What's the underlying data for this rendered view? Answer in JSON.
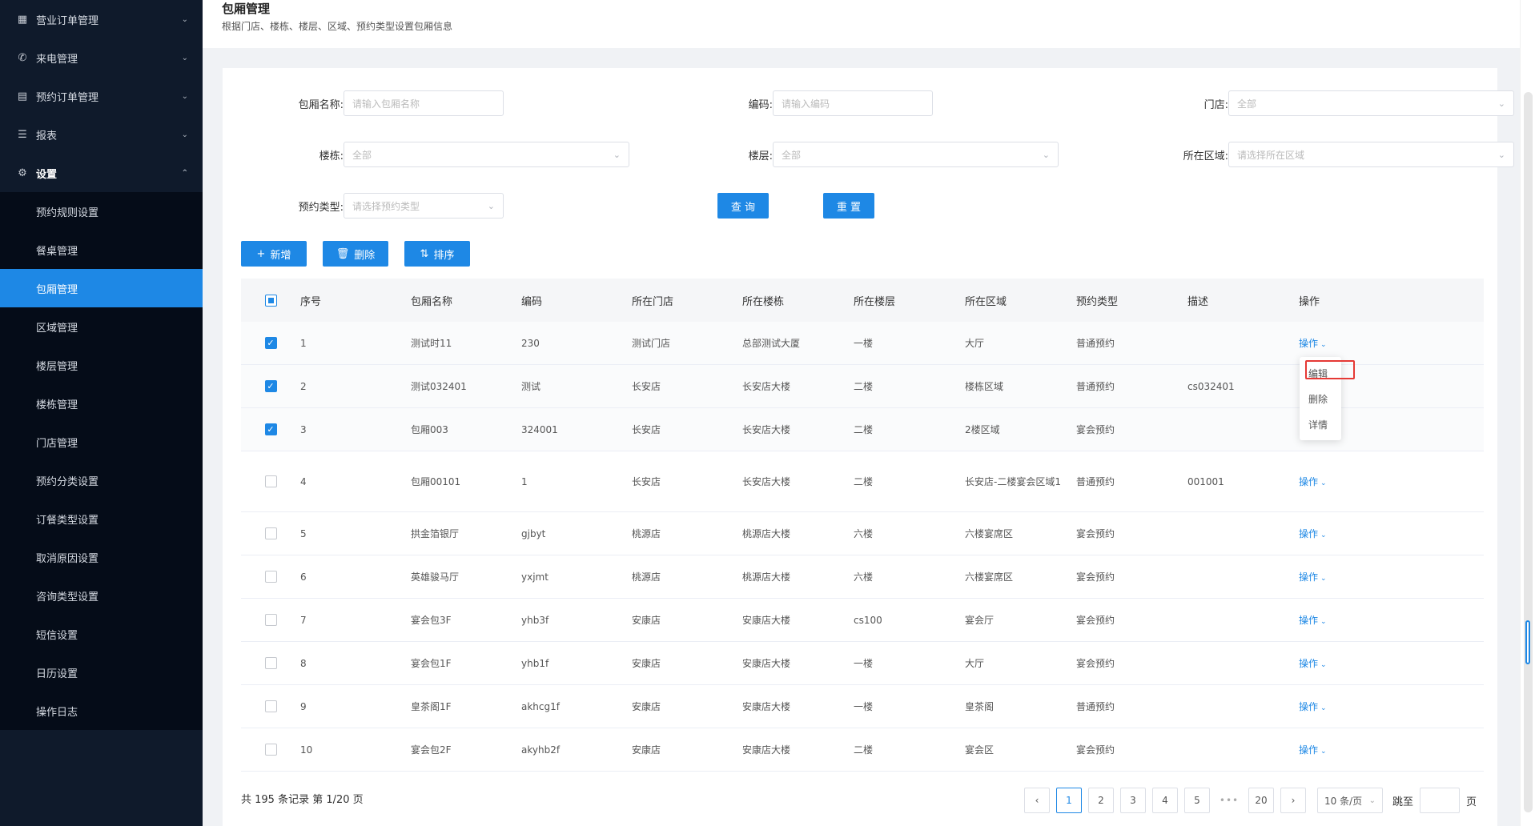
{
  "sidebar": {
    "menus": [
      {
        "label": "营业订单管理",
        "icon": "grid-icon",
        "glyph": "▦",
        "arrow": "⌄"
      },
      {
        "label": "来电管理",
        "icon": "phone-icon",
        "glyph": "✆",
        "arrow": "⌄"
      },
      {
        "label": "预约订单管理",
        "icon": "list-icon",
        "glyph": "▤",
        "arrow": "⌄"
      },
      {
        "label": "报表",
        "icon": "menu-icon",
        "glyph": "☰",
        "arrow": "⌄"
      },
      {
        "label": "设置",
        "icon": "gear-icon",
        "glyph": "⚙",
        "arrow": "⌃"
      }
    ],
    "submenu": [
      "预约规则设置",
      "餐桌管理",
      "包厢管理",
      "区域管理",
      "楼层管理",
      "楼栋管理",
      "门店管理",
      "预约分类设置",
      "订餐类型设置",
      "取消原因设置",
      "咨询类型设置",
      "短信设置",
      "日历设置",
      "操作日志"
    ],
    "active": "包厢管理"
  },
  "header": {
    "title": "包厢管理",
    "desc": "根据门店、楼栋、楼层、区域、预约类型设置包厢信息"
  },
  "filters": {
    "name_label": "包厢名称:",
    "name_placeholder": "请输入包厢名称",
    "code_label": "编码:",
    "code_placeholder": "请输入编码",
    "store_label": "门店:",
    "store_value": "全部",
    "building_label": "楼栋:",
    "building_value": "全部",
    "floor_label": "楼层:",
    "floor_value": "全部",
    "area_label": "所在区域:",
    "area_placeholder": "请选择所在区域",
    "type_label": "预约类型:",
    "type_placeholder": "请选择预约类型",
    "query_btn": "查 询",
    "reset_btn": "重 置"
  },
  "toolbar": {
    "add": "新增",
    "delete": "删除",
    "sort": "排序"
  },
  "table": {
    "columns": [
      "序号",
      "包厢名称",
      "编码",
      "所在门店",
      "所在楼栋",
      "所在楼层",
      "所在区域",
      "预约类型",
      "描述",
      "操作"
    ],
    "rows": [
      {
        "checked": true,
        "no": "1",
        "name": "测试时11",
        "code": "230",
        "store": "测试门店",
        "building": "总部测试大厦",
        "floor": "一楼",
        "area": "大厅",
        "type": "普通预约",
        "desc": "",
        "op": "操作"
      },
      {
        "checked": true,
        "no": "2",
        "name": "测试032401",
        "code": "测试",
        "store": "长安店",
        "building": "长安店大楼",
        "floor": "二楼",
        "area": "楼栋区域",
        "type": "普通预约",
        "desc": "cs032401",
        "op": ""
      },
      {
        "checked": true,
        "no": "3",
        "name": "包厢003",
        "code": "324001",
        "store": "长安店",
        "building": "长安店大楼",
        "floor": "二楼",
        "area": "2楼区域",
        "type": "宴会预约",
        "desc": "",
        "op": ""
      },
      {
        "checked": false,
        "no": "4",
        "name": "包厢00101",
        "code": "1",
        "store": "长安店",
        "building": "长安店大楼",
        "floor": "二楼",
        "area": "长安店-二楼宴会区域1",
        "type": "普通预约",
        "desc": "001001",
        "op": "操作"
      },
      {
        "checked": false,
        "no": "5",
        "name": "拱金箔银厅",
        "code": "gjbyt",
        "store": "桃源店",
        "building": "桃源店大楼",
        "floor": "六楼",
        "area": "六楼宴席区",
        "type": "宴会预约",
        "desc": "",
        "op": "操作"
      },
      {
        "checked": false,
        "no": "6",
        "name": "英雄骏马厅",
        "code": "yxjmt",
        "store": "桃源店",
        "building": "桃源店大楼",
        "floor": "六楼",
        "area": "六楼宴席区",
        "type": "宴会预约",
        "desc": "",
        "op": "操作"
      },
      {
        "checked": false,
        "no": "7",
        "name": "宴会包3F",
        "code": "yhb3f",
        "store": "安康店",
        "building": "安康店大楼",
        "floor": "cs100",
        "area": "宴会厅",
        "type": "宴会预约",
        "desc": "",
        "op": "操作"
      },
      {
        "checked": false,
        "no": "8",
        "name": "宴会包1F",
        "code": "yhb1f",
        "store": "安康店",
        "building": "安康店大楼",
        "floor": "一楼",
        "area": "大厅",
        "type": "宴会预约",
        "desc": "",
        "op": "操作"
      },
      {
        "checked": false,
        "no": "9",
        "name": "皇茶阁1F",
        "code": "akhcg1f",
        "store": "安康店",
        "building": "安康店大楼",
        "floor": "一楼",
        "area": "皇茶阁",
        "type": "普通预约",
        "desc": "",
        "op": "操作"
      },
      {
        "checked": false,
        "no": "10",
        "name": "宴会包2F",
        "code": "akyhb2f",
        "store": "安康店",
        "building": "安康店大楼",
        "floor": "二楼",
        "area": "宴会区",
        "type": "宴会预约",
        "desc": "",
        "op": "操作"
      }
    ]
  },
  "dropdown": {
    "items": [
      "编辑",
      "删除",
      "详情"
    ],
    "highlighted": "编辑"
  },
  "pagination": {
    "total_text": "共 195 条记录 第 1/20 页",
    "pages": [
      "1",
      "2",
      "3",
      "4",
      "5"
    ],
    "ellipsis": "•••",
    "last": "20",
    "current": "1",
    "page_size": "10 条/页",
    "jump_label": "跳至",
    "page_unit": "页",
    "prev": "‹",
    "next": "›"
  },
  "colors": {
    "primary": "#1e88e5",
    "sidebar_bg": "#0f1a2b",
    "highlight_border": "#e53935"
  }
}
